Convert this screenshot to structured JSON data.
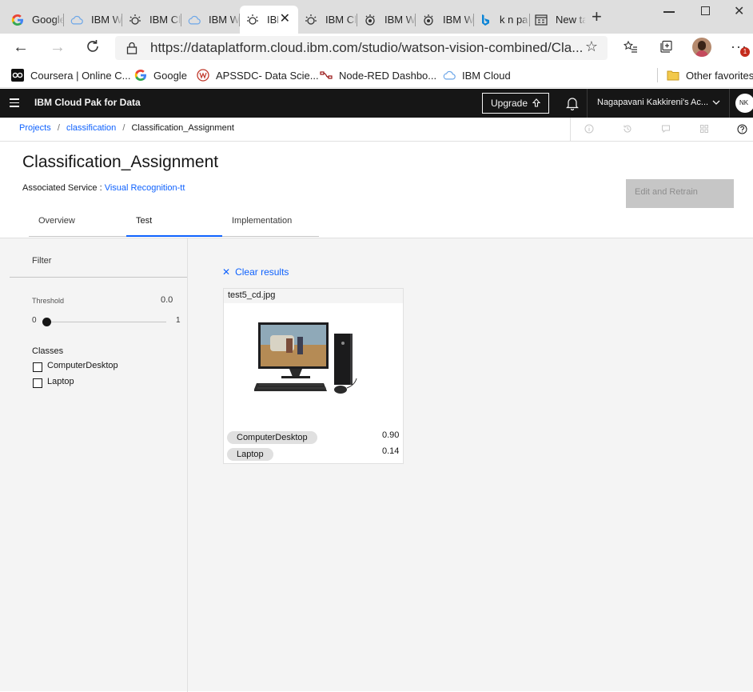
{
  "browser": {
    "tabs": [
      {
        "title": "Google",
        "icon": "google-icon"
      },
      {
        "title": "IBM W",
        "icon": "cloud-icon"
      },
      {
        "title": "IBM Cl",
        "icon": "watson-bulb-icon"
      },
      {
        "title": "IBM W",
        "icon": "cloud-icon"
      },
      {
        "title": "IBI",
        "icon": "watson-bulb-icon",
        "active": true
      },
      {
        "title": "IBM Cl",
        "icon": "watson-bulb-icon"
      },
      {
        "title": "IBM W",
        "icon": "watson-studio-icon"
      },
      {
        "title": "IBM W",
        "icon": "watson-studio-icon"
      },
      {
        "title": "k n pa",
        "icon": "bing-icon"
      },
      {
        "title": "New ta",
        "icon": "new-tab-icon"
      }
    ],
    "url": "https://dataplatform.cloud.ibm.com/studio/watson-vision-combined/Cla...",
    "favorites": [
      {
        "label": "Coursera | Online C...",
        "icon": "coursera-icon"
      },
      {
        "label": "Google",
        "icon": "google-icon"
      },
      {
        "label": "APSSDC- Data Scie...",
        "icon": "apssdc-icon"
      },
      {
        "label": "Node-RED Dashbo...",
        "icon": "node-red-icon"
      },
      {
        "label": "IBM Cloud",
        "icon": "cloud-icon"
      }
    ],
    "other_favorites": "Other favorites",
    "notification_count": "1"
  },
  "header": {
    "product": "IBM Cloud Pak for Data",
    "upgrade_label": "Upgrade",
    "account": "Nagapavani Kakkireni's Ac...",
    "avatar_initials": "NK"
  },
  "breadcrumb": {
    "projects": "Projects",
    "classification": "classification",
    "current": "Classification_Assignment",
    "sep": "/"
  },
  "page": {
    "title": "Classification_Assignment",
    "service_label": "Associated Service :",
    "service_link": "Visual Recognition-tt",
    "edit_retrain": "Edit and Retrain",
    "tabs": [
      "Overview",
      "Test",
      "Implementation"
    ],
    "selected_tab": "Test"
  },
  "filter": {
    "title": "Filter",
    "threshold_label": "Threshold",
    "threshold_value": "0.0",
    "threshold_fraction": 0,
    "slider_min": "0",
    "slider_max": "1",
    "classes_label": "Classes",
    "classes": [
      "ComputerDesktop",
      "Laptop"
    ]
  },
  "results": {
    "clear_label": "Clear results",
    "filename": "test5_cd.jpg",
    "scores": [
      {
        "label": "ComputerDesktop",
        "score": "0.90"
      },
      {
        "label": "Laptop",
        "score": "0.14"
      }
    ]
  },
  "colors": {
    "accent": "#0f62fe",
    "header_bg": "#161616",
    "content_bg": "#f4f4f4",
    "disabled_btn": "#c6c6c6"
  }
}
